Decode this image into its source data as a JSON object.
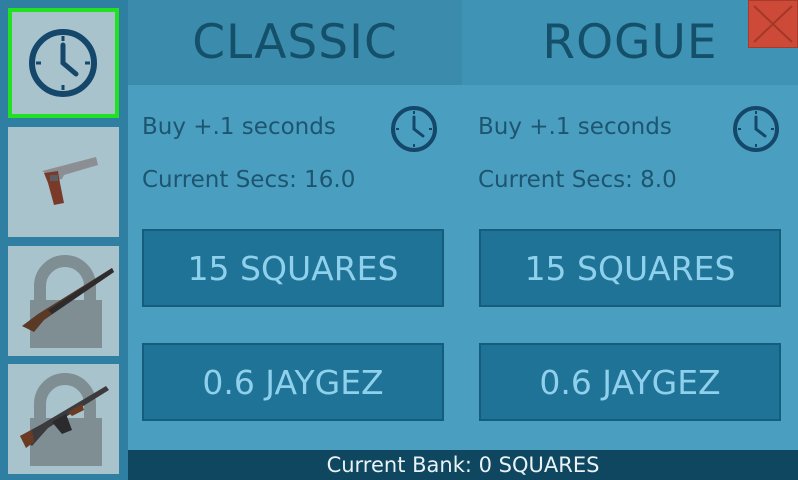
{
  "modes": [
    {
      "title": "CLASSIC",
      "buy_label": "Buy +.1 seconds",
      "current_secs": "Current Secs: 16.0",
      "price_squares": "15 SQUARES",
      "price_jaygez": "0.6 JAYGEZ"
    },
    {
      "title": "ROGUE",
      "buy_label": "Buy +.1 seconds",
      "current_secs": "Current Secs: 8.0",
      "price_squares": "15 SQUARES",
      "price_jaygez": "0.6 JAYGEZ"
    }
  ],
  "bank": "Current Bank: 0 SQUARES",
  "sidebar": {
    "items": [
      {
        "icon": "clock-icon",
        "selected": true
      },
      {
        "icon": "pistol-icon",
        "locked": false
      },
      {
        "icon": "shotgun-icon",
        "locked": true
      },
      {
        "icon": "rifle-icon",
        "locked": true
      }
    ]
  },
  "colors": {
    "selected_border": "#22e022",
    "close": "#cc4a37",
    "bank_bar": "#0f4660"
  }
}
